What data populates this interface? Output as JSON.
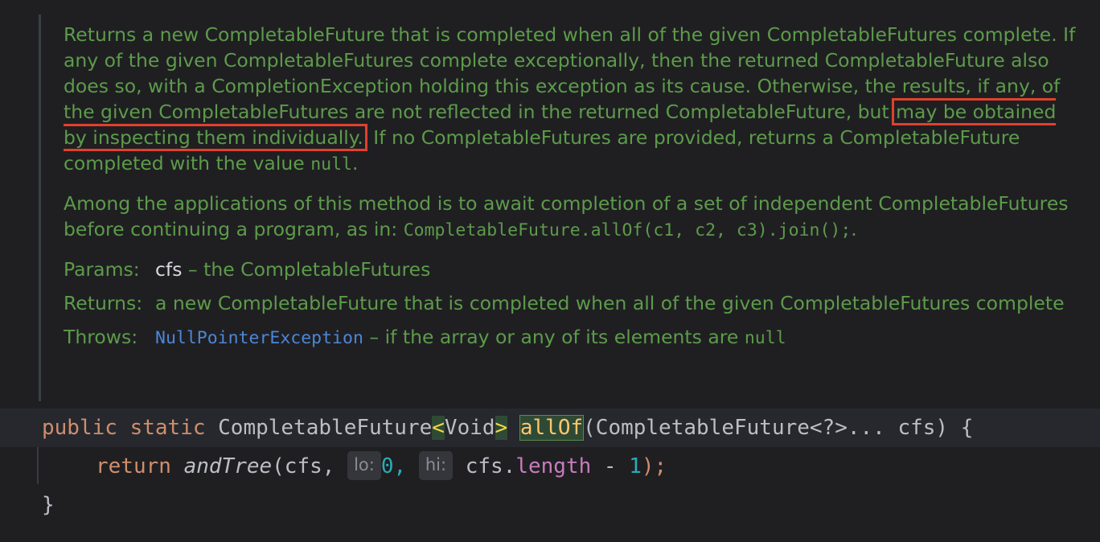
{
  "doc": {
    "p1_a": "Returns a new CompletableFuture that is completed when all of the given CompletableFutures complete. If any of the given CompletableFutures complete exceptionally, then the returned CompletableFuture also does so, with a CompletionException holding this exception as its cause. Otherwise, the results, if any, of the given CompletableFutures are not reflected in the returned CompletableFuture, but",
    "p1_highlight": "may be obtained by inspecting them individually.",
    "p1_b": " If no CompletableFutures are provided, returns a CompletableFuture completed with the value ",
    "p1_null": "null",
    "p1_end": ".",
    "p2_a": "Among the applications of this method is to await completion of a set of independent CompletableFutures before continuing a program, as in: ",
    "p2_code": "CompletableFuture.allOf(c1, c2, c3).join();",
    "p2_end": ".",
    "params_label": "Params:",
    "params_name": "cfs",
    "params_desc": " – the CompletableFutures",
    "returns_label": "Returns:",
    "returns_desc": "a new CompletableFuture that is completed when all of the given CompletableFutures complete",
    "throws_label": "Throws:",
    "throws_exception": "NullPointerException",
    "throws_desc": " – if the array or any of its elements are ",
    "throws_null": "null"
  },
  "code": {
    "line1": {
      "kw_public": "public",
      "kw_static": "static",
      "return_type": "CompletableFuture",
      "lt": "<",
      "generic": "Void",
      "gt": ">",
      "method_name": "allOf",
      "params": "(CompletableFuture<?>... cfs) {"
    },
    "line2": {
      "kw_return": "return",
      "call": "andTree",
      "arg1": "(cfs, ",
      "hint_lo": "lo:",
      "zero": "0",
      "comma": ", ",
      "hint_hi": "hi:",
      "cfs_dot": " cfs.",
      "length_field": "length",
      "minus": " - ",
      "one": "1",
      "close": ");"
    },
    "line3": {
      "brace": "}"
    }
  },
  "colors": {
    "doc_text": "#5d9b4a",
    "highlight_border": "#e0412d",
    "keyword": "#cf8e6d",
    "number": "#2aacb8",
    "field": "#c77dbb",
    "link": "#4d86d6"
  }
}
